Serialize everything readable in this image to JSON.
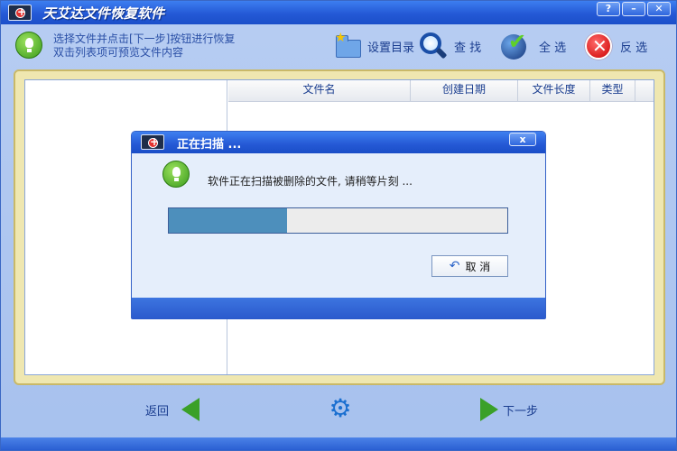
{
  "window": {
    "title": "天艾达文件恢复软件",
    "buttons": [
      "?",
      "–",
      "✕"
    ]
  },
  "toolbar": {
    "hint_line1": "选择文件并点击[下一步]按钮进行恢复",
    "hint_line2": "双击列表项可预览文件内容",
    "set_dir_label": "设置目录",
    "find_label": "查 找",
    "select_all_label": "全 选",
    "invert_label": "反 选"
  },
  "table": {
    "columns": [
      "文件名",
      "创建日期",
      "文件长度",
      "类型"
    ]
  },
  "bottom": {
    "back_label": "返回",
    "next_label": "下一步"
  },
  "dialog": {
    "title": "正在扫描 ...",
    "close_label": "x",
    "message": "软件正在扫描被删除的文件, 请稍等片刻 ...",
    "progress_fraction": 0.35,
    "cancel_label": "取 消"
  },
  "icons": {
    "app": "app-icon",
    "hint": "lightbulb-icon",
    "set_dir": "folder-star-icon",
    "find": "magnifier-icon",
    "select_all": "globe-check-icon",
    "invert": "red-x-icon",
    "back": "green-arrow-left-icon",
    "settings": "gear-icon",
    "next": "green-arrow-right-icon",
    "cancel": "undo-icon"
  },
  "colors": {
    "titlebar": "#2459d6",
    "accent_text": "#1a3d8f",
    "progress_fill": "#4d8fbc",
    "frame_border": "#c9b968"
  }
}
